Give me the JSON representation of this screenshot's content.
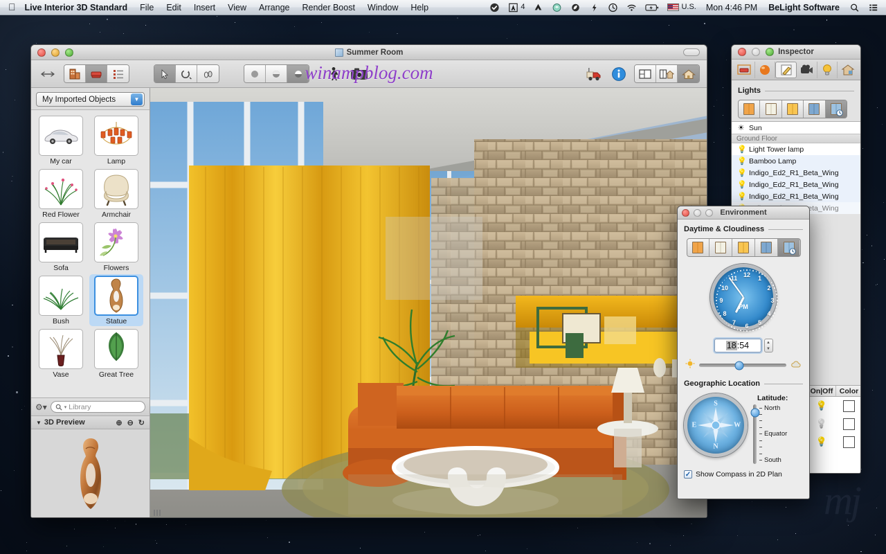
{
  "menubar": {
    "apple": "apple-logo",
    "app_name": "Live Interior 3D Standard",
    "items": [
      "File",
      "Edit",
      "Insert",
      "View",
      "Arrange",
      "Render Boost",
      "Window",
      "Help"
    ],
    "status_icons": [
      "checkmark-icon",
      "adobe-icon",
      "google-drive-icon",
      "dropbox-icon",
      "evernote-icon",
      "flash-icon",
      "time-machine-icon",
      "wifi-icon",
      "battery-icon"
    ],
    "adobe_badge": "4",
    "input_source": "U.S.",
    "clock": "Mon 4:46 PM",
    "user": "BeLight Software",
    "spotlight": "search-icon",
    "notifications": "notification-center-icon"
  },
  "document": {
    "title": "Summer Room",
    "watermark": "winampblog.com",
    "toolbar": {
      "resize_icon": "resize-arrows-icon",
      "group_view": [
        "building-icon",
        "furniture-icon",
        "list-icon"
      ],
      "group_tools": [
        "arrow-select-icon",
        "rotate-icon",
        "walk-icon"
      ],
      "group_render": [
        "flat-shade-icon",
        "shaded-icon",
        "photo-shade-icon"
      ],
      "walkthrough_icon": "walkthrough-person-icon",
      "camera_icon": "camera-icon",
      "render_icon": "render-truck-icon",
      "info_icon": "info-icon",
      "view_modes": [
        "2d-plan-icon",
        "split-view-icon",
        "3d-view-icon"
      ]
    }
  },
  "library": {
    "collection": "My Imported Objects",
    "dropdown_icon": "chevron-down-icon",
    "items": [
      {
        "label": "My car",
        "icon": "car-thumbnail",
        "selected": false
      },
      {
        "label": "Lamp",
        "icon": "chandelier-thumbnail",
        "selected": false
      },
      {
        "label": "Red Flower",
        "icon": "red-flower-thumbnail",
        "selected": false
      },
      {
        "label": "Armchair",
        "icon": "armchair-thumbnail",
        "selected": false
      },
      {
        "label": "Sofa",
        "icon": "sofa-thumbnail",
        "selected": false
      },
      {
        "label": "Flowers",
        "icon": "flowers-thumbnail",
        "selected": false
      },
      {
        "label": "Bush",
        "icon": "bush-thumbnail",
        "selected": false
      },
      {
        "label": "Statue",
        "icon": "statue-thumbnail",
        "selected": true
      },
      {
        "label": "Vase",
        "icon": "vase-thumbnail",
        "selected": false
      },
      {
        "label": "Great Tree",
        "icon": "tree-thumbnail",
        "selected": false
      }
    ],
    "gear_icon": "gear-icon",
    "search_placeholder": "Library",
    "search_icon": "search-icon",
    "preview_title": "3D Preview",
    "preview_disclosure": "disclosure-triangle-icon",
    "preview_tools": [
      "zoom-in-icon",
      "zoom-out-icon",
      "rotate-icon"
    ]
  },
  "inspector": {
    "title": "Inspector",
    "tabs": [
      "object-tab-icon",
      "material-tab-icon",
      "edit-tab-icon",
      "camera-tab-icon",
      "light-tab-icon",
      "building-tab-icon"
    ],
    "section_title": "Lights",
    "light_modes": [
      "window-warm-icon",
      "window-day-icon",
      "window-evening-icon",
      "window-night-icon",
      "window-auto-icon"
    ],
    "selected_mode_index": 4,
    "lights": [
      {
        "name": "Sun",
        "icon": "sun-icon",
        "group": false
      },
      {
        "name": "Ground Floor",
        "icon": "",
        "group": true
      },
      {
        "name": "Light Tower lamp",
        "icon": "bulb-on-icon",
        "group": false
      },
      {
        "name": "Bamboo Lamp",
        "icon": "bulb-off-icon",
        "group": false
      },
      {
        "name": "Indigo_Ed2_R1_Beta_Wing",
        "icon": "bulb-off-icon",
        "group": false
      },
      {
        "name": "Indigo_Ed2_R1_Beta_Wing",
        "icon": "bulb-off-icon",
        "group": false
      },
      {
        "name": "Indigo_Ed2_R1_Beta_Wing",
        "icon": "bulb-off-icon",
        "group": false
      },
      {
        "name": "Indigo_Ed2_R1_Beta_Wing",
        "icon": "bulb-off-icon",
        "group": false
      }
    ],
    "columns": [
      "On|Off",
      "Color"
    ],
    "light_rows": [
      {
        "state": "bulb-on-icon",
        "color": "#ffffff"
      },
      {
        "state": "bulb-off-icon",
        "color": "#ffffff"
      },
      {
        "state": "bulb-on-icon",
        "color": "#ffffff"
      }
    ]
  },
  "environment": {
    "title": "Environment",
    "daytime_title": "Daytime & Cloudiness",
    "daytime_modes": [
      "window-warm-icon",
      "window-day-icon",
      "window-evening-icon",
      "window-night-icon",
      "window-auto-icon"
    ],
    "selected_mode_index": 4,
    "clock": {
      "hours_label": "PM",
      "numbers": [
        "12",
        "1",
        "2",
        "3",
        "4",
        "5",
        "6",
        "7",
        "8",
        "9",
        "10",
        "11"
      ],
      "hour_angle": 207,
      "minute_angle": 324
    },
    "time_value": "18:54",
    "time_hours": "18",
    "time_minutes": ":54",
    "stepper_icon": "stepper-arrows-icon",
    "cloud_slider": {
      "left_icon": "sun-icon",
      "right_icon": "cloud-icon",
      "value_pct": 46
    },
    "geo_title": "Geographic Location",
    "compass": {
      "n": "N",
      "e": "E",
      "s": "S",
      "w": "W"
    },
    "latitude_label": "Latitude:",
    "latitude_ticks": [
      "North",
      "",
      "",
      "",
      "Equator",
      "",
      "",
      "",
      "South"
    ],
    "latitude_pct": 14,
    "checkbox_label": "Show Compass in 2D Plan",
    "checkbox_checked": "✓"
  },
  "colors": {
    "accent_blue": "#3b8fd6",
    "selection_blue": "#bcd9f5",
    "curtain_yellow": "#e8a81c",
    "sofa_orange": "#d4631f",
    "stone_wall": "#b9a489",
    "window_chrome": "#d4d4d4"
  }
}
